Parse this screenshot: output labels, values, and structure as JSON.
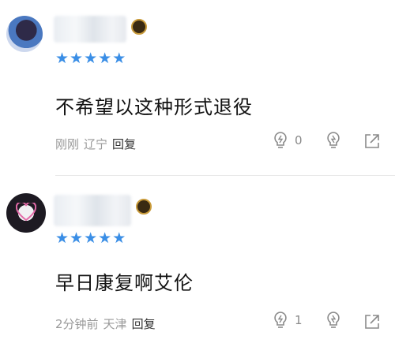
{
  "comments": [
    {
      "text": "不希望以这种形式退役",
      "time": "刚刚",
      "location": "辽宁",
      "reply_label": "回复",
      "like_count": "0",
      "star_count": 5
    },
    {
      "text": "早日康复啊艾伦",
      "time": "2分钟前",
      "location": "天津",
      "reply_label": "回复",
      "like_count": "1",
      "star_count": 5
    }
  ],
  "colors": {
    "star": "#3a8ee6",
    "meta_text": "#9a9a9a",
    "comment_text": "#111111",
    "icon_stroke": "#8a8a8a"
  },
  "icons": {
    "like": "lightbulb-icon",
    "dislike": "lightning-bulb-icon",
    "share": "share-icon",
    "star": "star-icon",
    "badge": "level-badge-icon"
  }
}
